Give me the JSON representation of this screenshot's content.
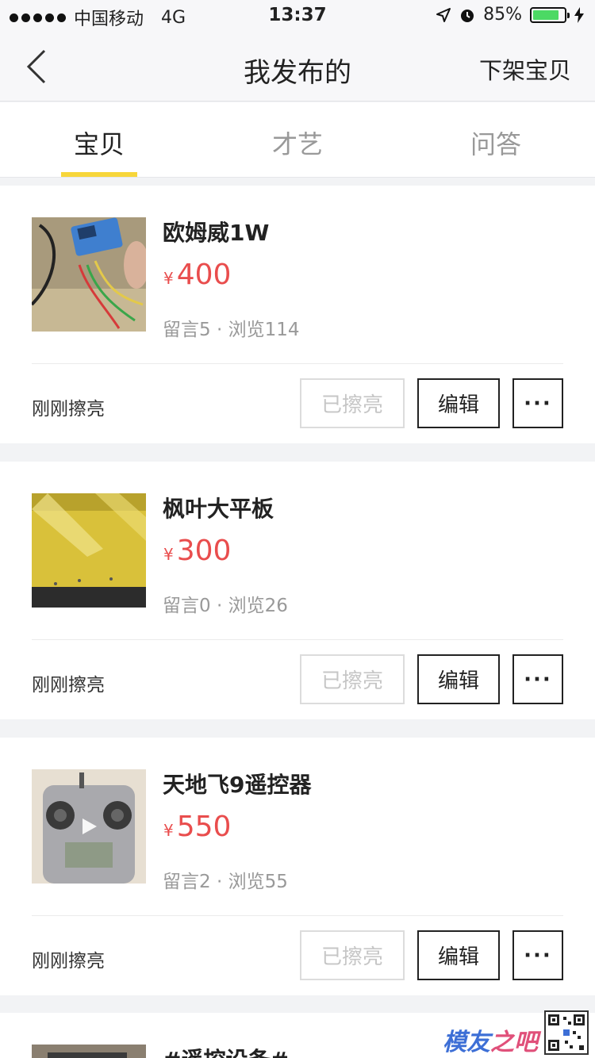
{
  "status_bar": {
    "carrier": "中国移动",
    "network": "4G",
    "time": "13:37",
    "battery": "85%",
    "battery_level": 0.85
  },
  "nav": {
    "title": "我发布的",
    "action": "下架宝贝"
  },
  "tabs": [
    {
      "label": "宝贝",
      "active": true
    },
    {
      "label": "才艺",
      "active": false
    },
    {
      "label": "问答",
      "active": false
    }
  ],
  "items": [
    {
      "title": "欧姆威1W",
      "currency": "¥",
      "price": "400",
      "stats": "留言5 · 浏览114",
      "refresh_time": "刚刚擦亮",
      "polished_label": "已擦亮",
      "edit_label": "编辑",
      "more_label": "···"
    },
    {
      "title": "枫叶大平板",
      "currency": "¥",
      "price": "300",
      "stats": "留言0 · 浏览26",
      "refresh_time": "刚刚擦亮",
      "polished_label": "已擦亮",
      "edit_label": "编辑",
      "more_label": "···"
    },
    {
      "title": "天地飞9遥控器",
      "currency": "¥",
      "price": "550",
      "stats": "留言2 · 浏览55",
      "refresh_time": "刚刚擦亮",
      "polished_label": "已擦亮",
      "edit_label": "编辑",
      "more_label": "···"
    },
    {
      "title": "#遥控设备#"
    }
  ],
  "watermark": {
    "brand": "模友",
    "suffix": "之吧"
  },
  "colors": {
    "accent_yellow": "#f7d63a",
    "price_red": "#e94d4d",
    "battery_green": "#4cd964"
  }
}
